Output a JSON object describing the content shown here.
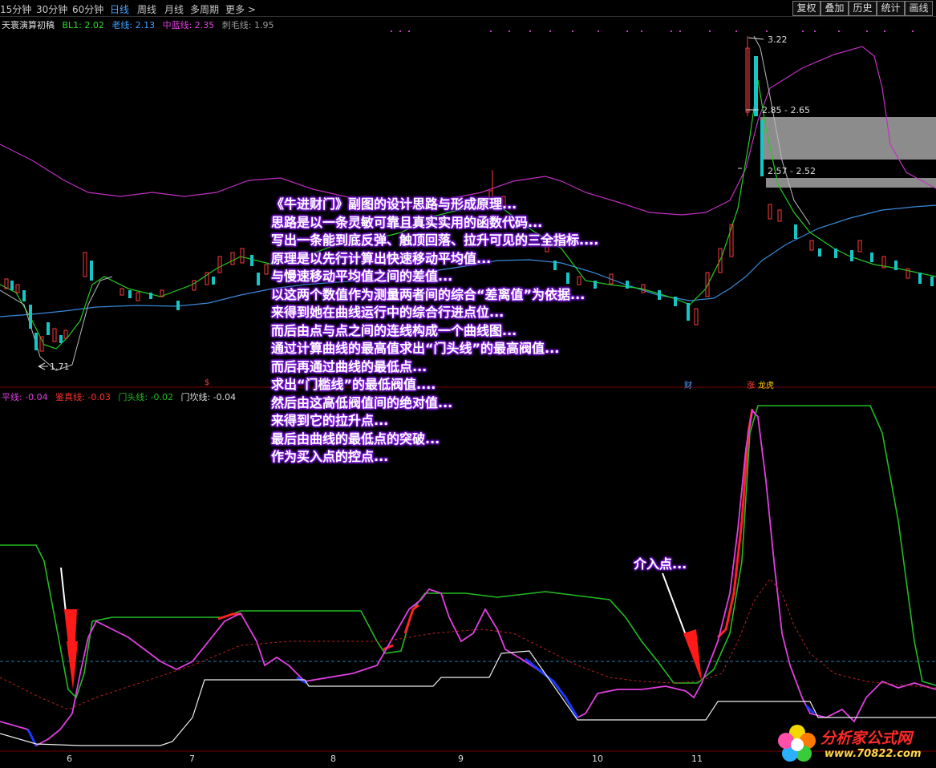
{
  "toolbar": {
    "periods": [
      "15分钟",
      "30分钟",
      "60分钟",
      "日线",
      "周线",
      "月线",
      "多周期",
      "更多 >"
    ],
    "active_period": "日线",
    "buttons": [
      "复权",
      "叠加",
      "历史",
      "统计",
      "画线"
    ]
  },
  "main_legend": {
    "indicator_name": "天寰演算初稿",
    "items": [
      {
        "label": "BL1: 2.02",
        "color": "#22dd22"
      },
      {
        "label": "老线: 2.13",
        "color": "#3fa0ff"
      },
      {
        "label": "中蓝线: 2.35",
        "color": "#e040e0"
      },
      {
        "label": "刺毛线: 1.95",
        "color": "#9a9a9a"
      }
    ]
  },
  "sub_legend": {
    "items": [
      {
        "label": "平线: -0.04",
        "color": "#e040e0"
      },
      {
        "label": "鉴真线: -0.03",
        "color": "#ff3030"
      },
      {
        "label": "门头线: -0.02",
        "color": "#22bb22"
      },
      {
        "label": "门坎线: -0.04",
        "color": "#dddddd"
      }
    ]
  },
  "price_labels": {
    "high": "3.22",
    "zone1": "2.85 - 2.65",
    "zone2": "2.57 - 2.52",
    "low": "1.71"
  },
  "event_badges": [
    {
      "text": "$",
      "color": "#ff4040"
    },
    {
      "text": "财",
      "color": "#4aa3ff"
    },
    {
      "text": "涨",
      "color": "#ff4040"
    },
    {
      "text": "龙虎",
      "color": "#ffcc00"
    }
  ],
  "x_ticks": [
    "6",
    "7",
    "8",
    "9",
    "10",
    "11"
  ],
  "overlay_text": [
    "《牛进财门》副图的设计思路与形成原理...",
    "思路是以一条灵敏可靠且真实实用的函数代码...",
    "写出一条能到底反弹、触顶回落、拉升可见的三全指标....",
    "原理是以先行计算出快速移动平均值...",
    "与慢速移动平均值之间的差值...",
    "以这两个数值作为测量两者间的综合“差离值”为依据...",
    "来得到她在曲线运行中的综合行进点位...",
    "而后由点与点之间的连线构成一个曲线图...",
    "通过计算曲线的最高值求出“门头线”的最高阀值...",
    "而后再通过曲线的最低点...",
    "求出“门槛线”的最低阀值....",
    "然后由这高低阀值间的绝对值...",
    "来得到它的拉升点...",
    "最后由曲线的最低点的突破...",
    "作为买入点的控点..."
  ],
  "callout": "介入点...",
  "watermark": {
    "name": "分析家公式网",
    "url": "www.70822.com"
  }
}
